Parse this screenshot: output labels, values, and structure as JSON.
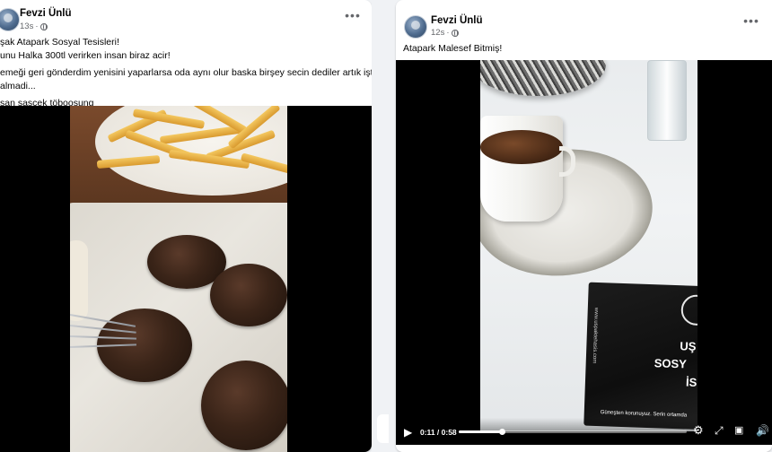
{
  "posts": [
    {
      "author": "Fevzi Ünlü",
      "time": "13s",
      "lines": [
        "şak Atapark Sosyal Tesisleri!",
        "unu Halka 300tl verirken insan biraz acir!",
        "emeği geri gönderdim yenisini yaparlarsa oda aynı olur baska birşey secin dediler artık iştah",
        "almadi...",
        "san şaşcek töboosung"
      ]
    },
    {
      "author": "Fevzi Ünlü",
      "time": "12s",
      "text": "Atapark Malesef Bitmiş!",
      "video": {
        "current_time": "0:11",
        "duration": "0:58",
        "progress": 0.19,
        "pack_title_1": "UŞ",
        "pack_title_2": "SOSY",
        "pack_title_3": "İS",
        "pack_vertical": "www.uspaktehasis.com",
        "pack_footer": "Güneşten korunuyuz. Serin ortamda"
      }
    }
  ],
  "icons": {
    "more": "more-horizontal-icon",
    "privacy": "globe-icon",
    "play": "play-icon",
    "settings": "gear-icon",
    "fullscreen": "expand-icon",
    "pip": "picture-in-picture-icon",
    "volume": "volume-icon"
  }
}
